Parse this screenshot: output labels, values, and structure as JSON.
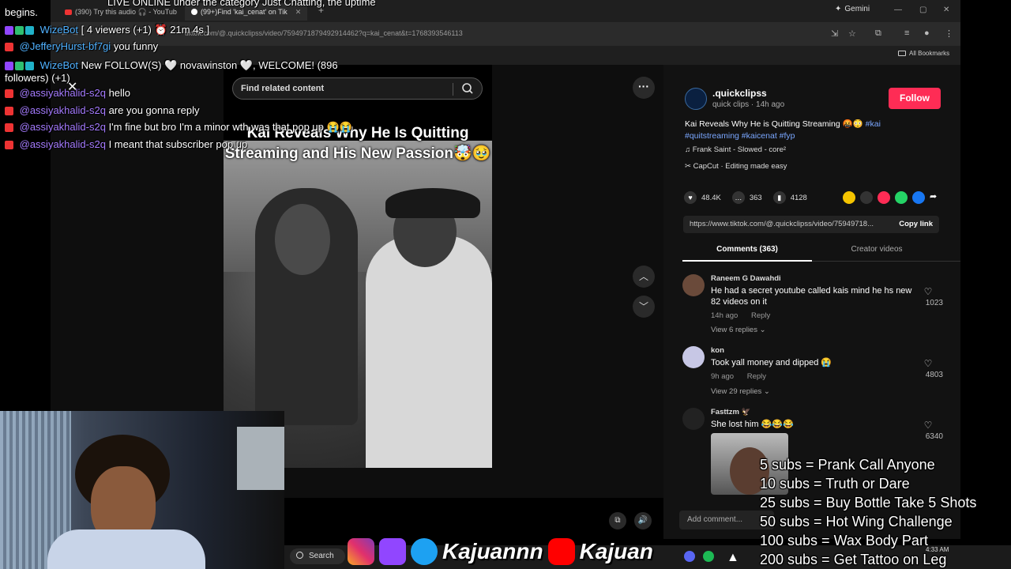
{
  "browser": {
    "tabs": [
      {
        "label": "(390) Try this audio 🎧 - YouTub",
        "icon": "youtube-icon"
      },
      {
        "label": "(99+)Find 'kai_cenat' on Tik",
        "icon": "tiktok-icon"
      }
    ],
    "gemini_label": "Gemini",
    "url": "tiktok.com/@.quickclipss/video/7594971879492914462?q=kai_cenat&t=1768393546113",
    "bookmarks_label": "All Bookmarks"
  },
  "tiktok": {
    "search_placeholder": "Find related content",
    "video_caption": "Kai Reveals Why He Is Quitting Streaming and His New Passion🤯🥹",
    "author": {
      "handle": ".quickclipss",
      "sub": "quick clips · 14h ago",
      "follow_label": "Follow"
    },
    "description": {
      "text": "Kai Reveals Why He is Quitting Streaming 🤬😳",
      "tags": [
        "#kai",
        "#quitstreaming",
        "#kaicenat",
        "#fyp"
      ]
    },
    "music": "Frank Saint - Slowed - core²",
    "capcut": "CapCut · Editing made easy",
    "stats": {
      "likes": "48.4K",
      "comments": "363",
      "saves": "4128"
    },
    "link": "https://www.tiktok.com/@.quickclipss/video/75949718...",
    "copy_link_label": "Copy link",
    "tabs": {
      "comments": "Comments (363)",
      "creator": "Creator videos"
    },
    "comments": [
      {
        "name": "Raneem G Dawahdi",
        "text": "He had a secret youtube called kais mind he hs new 82 videos on it",
        "time": "14h ago",
        "reply": "Reply",
        "replies": "View 6 replies",
        "likes": "1023"
      },
      {
        "name": "kon",
        "text": "Took yall money and dipped 😭",
        "time": "9h ago",
        "reply": "Reply",
        "replies": "View 29 replies",
        "likes": "4803"
      },
      {
        "name": "Fasttzm 🦅",
        "text": "She lost him 😂😂😂",
        "likes": "6340"
      }
    ],
    "add_comment": "Add comment..."
  },
  "stream": {
    "chat": [
      {
        "user": "",
        "text": "begins."
      },
      {
        "user": "WizeBot",
        "text": "[ 4 viewers (+1) ⏰ 21m 4s ]"
      },
      {
        "user": "@JefferyHurst-bf7gi",
        "text": "you funny"
      },
      {
        "user": "WizeBot",
        "text": "New FOLLOW(S) 🤍 novawinston 🤍, WELCOME! (896"
      },
      {
        "user": "",
        "text": "followers) (+1)"
      },
      {
        "user": "@assiyakhalid-s2q",
        "text": "hello"
      },
      {
        "user": "@assiyakhalid-s2q",
        "text": "are you gonna reply"
      },
      {
        "user": "@assiyakhalid-s2q",
        "text": "I'm fine but bro I'm a minor wth was that pop up 😭😭"
      },
      {
        "user": "@assiyakhalid-s2q",
        "text": "I meant that subscriber pop up"
      }
    ],
    "chat_top": "LIVE ONLINE under the category Just Chatting, the uptime",
    "brand_name": "Kajuannn",
    "brand_name2": "Kajuan",
    "sub_goals": [
      "5 subs =  Prank Call Anyone",
      "10 subs = Truth or Dare",
      "25 subs = Buy Bottle Take 5 Shots",
      "50 subs = Hot Wing Challenge",
      "100 subs = Wax Body Part",
      "200 subs = Get Tattoo on Leg"
    ],
    "taskbar_search": "Search",
    "clock": "4:33 AM"
  }
}
